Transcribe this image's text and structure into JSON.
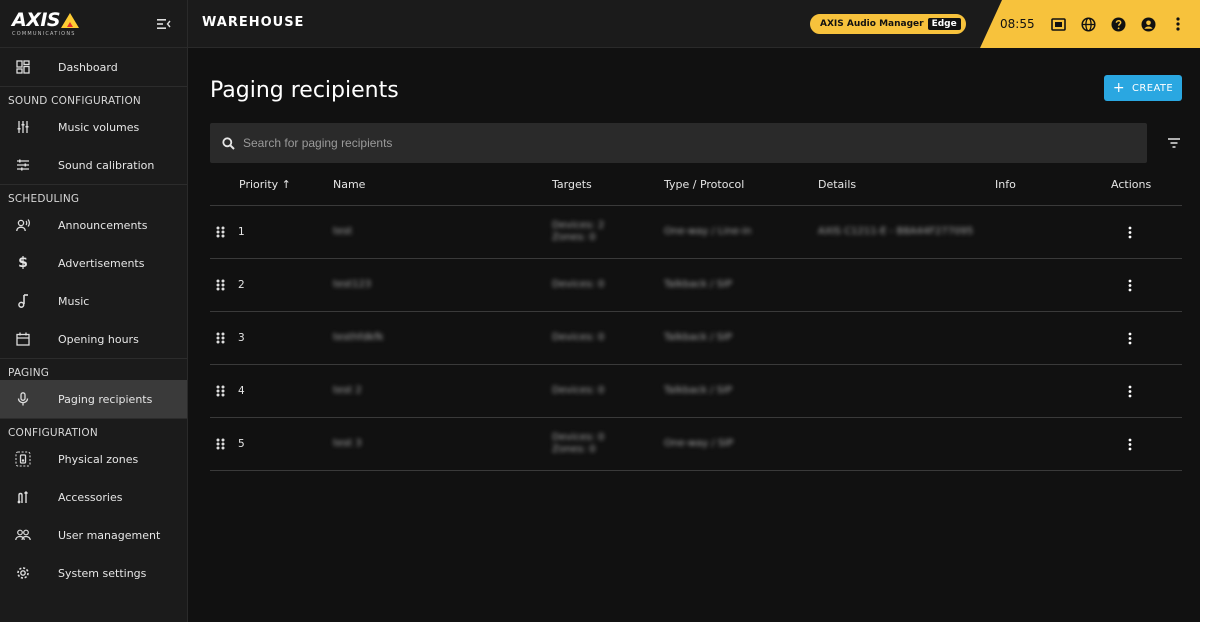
{
  "app": {
    "logo_text": "AXIS",
    "logo_sub": "COMMUNICATIONS",
    "site_title": "WAREHOUSE",
    "product_badge": "AXIS Audio Manager",
    "product_edition": "Edge",
    "clock": "08:55"
  },
  "colors": {
    "accent_yellow": "#f7c23c",
    "create_blue": "#2aa7e1",
    "background": "#111111",
    "sidebar": "#1b1b1b"
  },
  "sidebar": {
    "dashboard": "Dashboard",
    "sections": {
      "sound": "SOUND CONFIGURATION",
      "scheduling": "SCHEDULING",
      "paging": "PAGING",
      "configuration": "CONFIGURATION"
    },
    "items": {
      "music_volumes": "Music volumes",
      "sound_calibration": "Sound calibration",
      "announcements": "Announcements",
      "advertisements": "Advertisements",
      "music": "Music",
      "opening_hours": "Opening hours",
      "paging_recipients": "Paging recipients",
      "physical_zones": "Physical zones",
      "accessories": "Accessories",
      "user_management": "User management",
      "system_settings": "System settings"
    }
  },
  "main": {
    "title": "Paging recipients",
    "create_label": "CREATE",
    "search_placeholder": "Search for paging recipients",
    "columns": {
      "priority": "Priority ↑",
      "name": "Name",
      "targets": "Targets",
      "type": "Type / Protocol",
      "details": "Details",
      "info": "Info",
      "actions": "Actions"
    },
    "rows": [
      {
        "priority": "1",
        "name": "test",
        "targets_1": "Devices: 2",
        "targets_2": "Zones: 0",
        "type": "One-way / Line-in",
        "details": "AXIS C1211-E - B8A44F277095"
      },
      {
        "priority": "2",
        "name": "test123",
        "targets_1": "Devices: 0",
        "targets_2": "",
        "type": "Talkback / SIP",
        "details": ""
      },
      {
        "priority": "3",
        "name": "testhfdkfk",
        "targets_1": "Devices: 0",
        "targets_2": "",
        "type": "Talkback / SIP",
        "details": ""
      },
      {
        "priority": "4",
        "name": "test 2",
        "targets_1": "Devices: 0",
        "targets_2": "",
        "type": "Talkback / SIP",
        "details": ""
      },
      {
        "priority": "5",
        "name": "test 3",
        "targets_1": "Devices: 0",
        "targets_2": "Zones: 0",
        "type": "One-way / SIP",
        "details": ""
      }
    ]
  }
}
